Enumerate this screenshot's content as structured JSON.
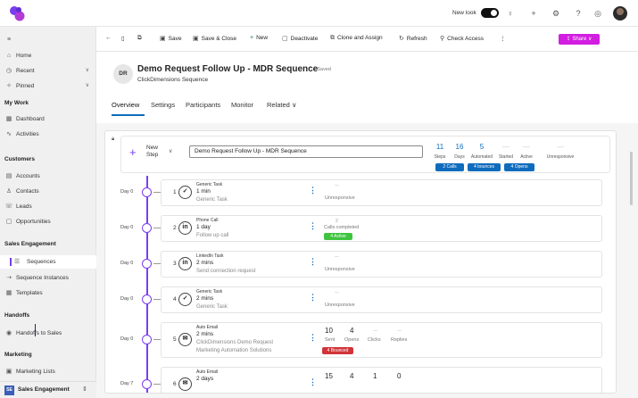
{
  "topbar": {
    "new_look_label": "New look",
    "icons": [
      "lightbulb-icon",
      "plus-icon",
      "gear-icon",
      "help-icon",
      "copilot-icon"
    ]
  },
  "sidebar": {
    "items": [
      {
        "label": "Home",
        "icon": "⌂"
      },
      {
        "label": "Recent",
        "icon": "◷"
      },
      {
        "label": "Pinned",
        "icon": "✧"
      }
    ],
    "my_work_heading": "My Work",
    "my_work_items": [
      {
        "label": "Dashboard",
        "icon": "▦"
      },
      {
        "label": "Activities",
        "icon": "∿"
      }
    ],
    "customers_heading": "Customers",
    "customer_items": [
      {
        "label": "Accounts",
        "icon": "▤"
      },
      {
        "label": "Contacts",
        "icon": "♙"
      },
      {
        "label": "Leads",
        "icon": "☏"
      },
      {
        "label": "Opportunities",
        "icon": "▢"
      }
    ],
    "sales_heading": "Sales Engagement",
    "sales_items": [
      {
        "label": "Sequences",
        "icon": "☰"
      },
      {
        "label": "Sequence Instances",
        "icon": "⇢"
      },
      {
        "label": "Templates",
        "icon": "▦"
      }
    ],
    "handoffs_heading": "Handoffs",
    "handoff_items": [
      {
        "label": "Handoffs to Sales",
        "icon": "◉"
      }
    ],
    "marketing_heading": "Marketing",
    "marketing_items": [
      {
        "label": "Marketing Lists",
        "icon": "▣"
      }
    ],
    "area_badge": "SE",
    "area_label": "Sales Engagement",
    "area_chevron": "⇕"
  },
  "commandbar": {
    "back": "←",
    "save": "Save",
    "save_close": "Save & Close",
    "new": "New",
    "deactivate": "Deactivate",
    "clone": "Clone and Assign",
    "refresh": "Refresh",
    "check_access": "Check Access",
    "more": "⋮",
    "share": "Share"
  },
  "record": {
    "initials": "DR",
    "title": "Demo Request Follow Up - MDR Sequence",
    "saved_status": "- Saved",
    "subtitle": "ClickDimensions Sequence",
    "tabs": [
      "Overview",
      "Settings",
      "Participants",
      "Monitor",
      "Related"
    ]
  },
  "sequence": {
    "new_step_label": "New Step",
    "name": "Demo Request Follow Up - MDR Sequence",
    "stats": [
      {
        "value": "11",
        "label": "Steps"
      },
      {
        "value": "16",
        "label": "Days"
      },
      {
        "value": "5",
        "label": "Automated"
      },
      {
        "value": "—",
        "label": "Started"
      },
      {
        "value": "—",
        "label": "Active"
      },
      {
        "value": "—",
        "label": "Unresponsive"
      }
    ],
    "pills": [
      "2 Calls",
      "4 bounces",
      "4 Opens"
    ]
  },
  "steps": [
    {
      "day": "Day 0",
      "num": "1",
      "icon": "task-icon",
      "glyph": "✓",
      "type": "Generic Task",
      "time": "1 min",
      "desc": "Generic Task",
      "kind": "unresponsive",
      "unresponsive_label": "Unresponsive",
      "dash": "—"
    },
    {
      "day": "Day 0",
      "num": "2",
      "icon": "phone-linkedin-icon",
      "glyph": "in",
      "type": "Phone Call",
      "time": "1 day",
      "desc": "Follow up call",
      "kind": "calls",
      "calls_value": "2",
      "calls_label": "Calls completed",
      "active_badge": "4 Active"
    },
    {
      "day": "Day 0",
      "num": "3",
      "icon": "linkedin-icon",
      "glyph": "in",
      "type": "LinkedIn Task",
      "time": "2 mins",
      "desc": "Send connection request",
      "kind": "unresponsive",
      "unresponsive_label": "Unresponsive",
      "dash": "—"
    },
    {
      "day": "Day 0",
      "num": "4",
      "icon": "task-icon",
      "glyph": "✓",
      "type": "Generic Task",
      "time": "2 mins",
      "desc": "Generic Task",
      "kind": "unresponsive",
      "unresponsive_label": "Unresponsive",
      "dash": "—"
    },
    {
      "day": "Day 0",
      "num": "5",
      "icon": "email-icon",
      "glyph": "✉",
      "type": "Auto Email",
      "time": "2 mins",
      "desc": "ClickDimensions Demo Request",
      "desc2": "Marketing Automation Solutions",
      "kind": "email",
      "sent": "10",
      "opens": "4",
      "clicks": "—",
      "replies": "—",
      "labels": [
        "Sent",
        "Opens",
        "Clicks",
        "Replies"
      ],
      "bounced_badge": "4 Bounced"
    },
    {
      "day": "Day 7",
      "num": "6",
      "icon": "email-icon",
      "glyph": "✉",
      "type": "Auto Email",
      "time": "2 days",
      "desc": "",
      "kind": "email-partial",
      "sent": "15",
      "opens": "4",
      "clicks": "1",
      "replies": "0"
    }
  ],
  "colors": {
    "accent": "#7a3df0",
    "brand_blue": "#0f6cbd",
    "share": "#d21ee0",
    "green": "#3ec43e",
    "red": "#d13438"
  }
}
